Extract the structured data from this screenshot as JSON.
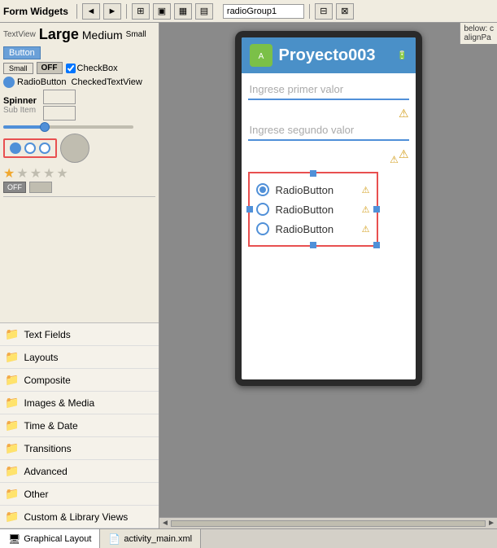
{
  "toolbar": {
    "title": "Form Widgets",
    "radiogroup_label": "radioGroup1",
    "nav_arrows": [
      "◄",
      "►"
    ],
    "buttons": [
      "⊞",
      "⊟",
      "⊠",
      "⊡"
    ]
  },
  "widgets": {
    "text_row": {
      "label": "TextView",
      "large": "Large",
      "medium": "Medium",
      "small": "Small",
      "button": "Button"
    },
    "controls": {
      "small_btn": "Small",
      "off_btn": "OFF",
      "checkbox_label": "CheckBox"
    },
    "radios": {
      "item1": "RadioButton",
      "item2": "CheckedTextView"
    },
    "spinner_label": "Spinner",
    "spinner_sub": "Sub Item",
    "toggle_off": "OFF",
    "toggle_on": ""
  },
  "sidebar": {
    "items": [
      {
        "id": "text-fields",
        "label": "Text Fields"
      },
      {
        "id": "layouts",
        "label": "Layouts"
      },
      {
        "id": "composite",
        "label": "Composite"
      },
      {
        "id": "images-media",
        "label": "Images & Media"
      },
      {
        "id": "time-date",
        "label": "Time & Date"
      },
      {
        "id": "transitions",
        "label": "Transitions"
      },
      {
        "id": "advanced",
        "label": "Advanced"
      },
      {
        "id": "other",
        "label": "Other"
      },
      {
        "id": "custom-library",
        "label": "Custom & Library Views"
      }
    ]
  },
  "canvas": {
    "app_title": "Proyecto003",
    "input1_placeholder": "Ingrese primer valor",
    "input2_placeholder": "Ingrese segundo valor",
    "radio_buttons": [
      {
        "label": "RadioButton",
        "checked": true,
        "warning": true
      },
      {
        "label": "RadioButton",
        "checked": false,
        "warning": true
      },
      {
        "label": "RadioButton",
        "checked": false,
        "warning": true
      }
    ]
  },
  "bottom_tabs": [
    {
      "id": "graphical-layout",
      "label": "Graphical Layout",
      "icon": "🖥"
    },
    {
      "id": "activity-main",
      "label": "activity_main.xml",
      "icon": "📄"
    }
  ],
  "right_panel": {
    "label": "below: c",
    "label2": "alignPa"
  }
}
